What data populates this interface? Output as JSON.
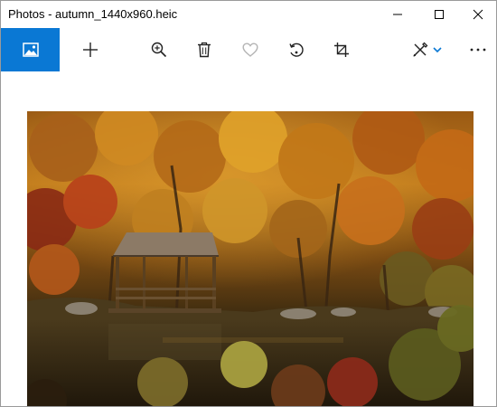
{
  "window": {
    "title": "Photos - autumn_1440x960.heic",
    "controls": {
      "minimize": "minimize-icon",
      "maximize": "maximize-icon",
      "close": "close-icon"
    }
  },
  "toolbar": {
    "items": [
      {
        "icon": "image-icon",
        "active": true
      },
      {
        "icon": "plus-icon"
      },
      {
        "icon": "zoom-in-icon"
      },
      {
        "icon": "trash-icon"
      },
      {
        "icon": "heart-icon",
        "disabled": true
      },
      {
        "icon": "rotate-icon"
      },
      {
        "icon": "crop-icon"
      },
      {
        "icon": "edit-draw-icon"
      },
      {
        "icon": "chevron-down-icon"
      },
      {
        "icon": "more-icon"
      }
    ],
    "accent": "#0a78d4"
  },
  "photo": {
    "subject": "autumn forest with wooden gazebo on lake",
    "colors": {
      "sky_foliage": "#b8701a",
      "dark_trees": "#3a2610",
      "water": "#2f2414",
      "gazebo_roof": "#8c7a66"
    }
  }
}
